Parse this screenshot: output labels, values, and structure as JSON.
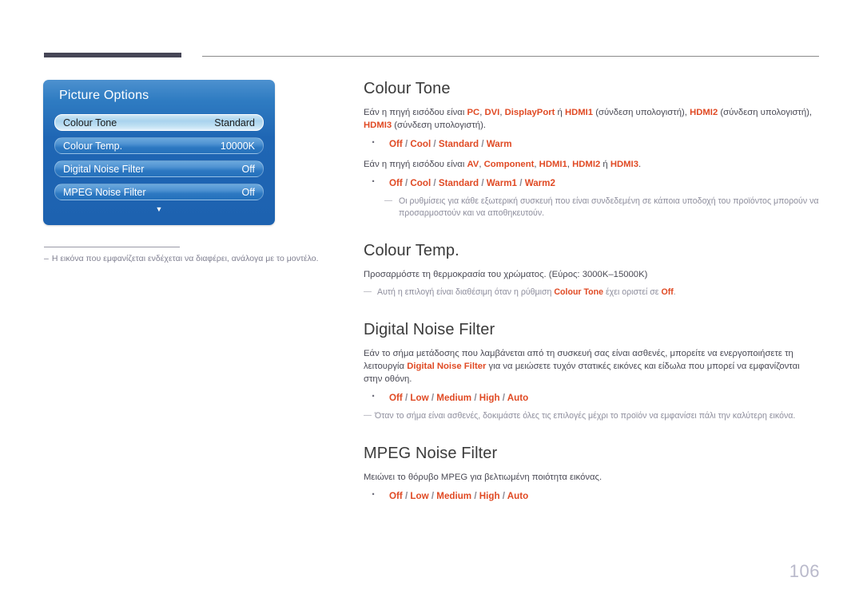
{
  "page": {
    "number": "106"
  },
  "osd": {
    "title": "Picture Options",
    "rows": [
      {
        "label": "Colour Tone",
        "value": "Standard",
        "selected": true
      },
      {
        "label": "Colour Temp.",
        "value": "10000K",
        "selected": false
      },
      {
        "label": "Digital Noise Filter",
        "value": "Off",
        "selected": false
      },
      {
        "label": "MPEG Noise Filter",
        "value": "Off",
        "selected": false
      }
    ],
    "scroll_arrow": "▼"
  },
  "left_note": {
    "dash": "–",
    "text": "Η εικόνα που εμφανίζεται ενδέχεται να διαφέρει, ανάλογα με το μοντέλο."
  },
  "sections": [
    {
      "title": "Colour Tone",
      "para1_a": "Εάν η πηγή εισόδου είναι ",
      "para1_pc": "PC",
      "para1_b": ", ",
      "para1_dvi": "DVI",
      "para1_c": ", ",
      "para1_dp": "DisplayPort",
      "para1_d": " ή ",
      "para1_hdmi1": "HDMI1",
      "para1_e": " (σύνδεση υπολογιστή), ",
      "para1_hdmi2": "HDMI2",
      "para1_f": " (σύνδεση υπολογιστή), ",
      "para1_hdmi3": "HDMI3",
      "para1_g": " (σύνδεση υπολογιστή).",
      "opts1": [
        "Off",
        "Cool",
        "Standard",
        "Warm"
      ],
      "para2_a": "Εάν η πηγή εισόδου είναι ",
      "para2_av": "AV",
      "para2_b": ", ",
      "para2_comp": "Component",
      "para2_c": ", ",
      "para2_hdmi1": "HDMI1",
      "para2_d": ", ",
      "para2_hdmi2": "HDMI2",
      "para2_e": " ή ",
      "para2_hdmi3": "HDMI3",
      "para2_f": ".",
      "opts2": [
        "Off",
        "Cool",
        "Standard",
        "Warm1",
        "Warm2"
      ],
      "note": "Οι ρυθμίσεις για κάθε εξωτερική συσκευή που είναι συνδεδεμένη σε κάποια υποδοχή του προϊόντος μπορούν να προσαρμοστούν και να αποθηκευτούν."
    },
    {
      "title": "Colour Temp.",
      "para": "Προσαρμόστε τη θερμοκρασία του χρώματος. (Εύρος: 3000K–15000K)",
      "note_a": "Αυτή η επιλογή είναι διαθέσιμη όταν η ρύθμιση ",
      "note_hl1": "Colour Tone",
      "note_b": " έχει οριστεί σε ",
      "note_hl2": "Off",
      "note_c": "."
    },
    {
      "title": "Digital Noise Filter",
      "para_a": "Εάν το σήμα μετάδοσης που λαμβάνεται από τη συσκευή σας είναι ασθενές, μπορείτε να ενεργοποιήσετε τη λειτουργία ",
      "para_hl": "Digital Noise Filter",
      "para_b": " για να μειώσετε τυχόν στατικές εικόνες και είδωλα που μπορεί να εμφανίζονται στην οθόνη.",
      "opts": [
        "Off",
        "Low",
        "Medium",
        "High",
        "Auto"
      ],
      "note": "Όταν το σήμα είναι ασθενές, δοκιμάστε όλες τις επιλογές μέχρι το προϊόν να εμφανίσει πάλι την καλύτερη εικόνα."
    },
    {
      "title": "MPEG Noise Filter",
      "para": "Μειώνει το θόρυβο MPEG για βελτιωμένη ποιότητα εικόνας.",
      "opts": [
        "Off",
        "Low",
        "Medium",
        "High",
        "Auto"
      ]
    }
  ],
  "colors": {
    "accent": "#e04a24",
    "heading": "#3b3b3b",
    "body": "#4a4a55",
    "muted": "#8e8e9d",
    "page_number": "#b9b9cb",
    "osd_blue": "#1f66b4"
  }
}
